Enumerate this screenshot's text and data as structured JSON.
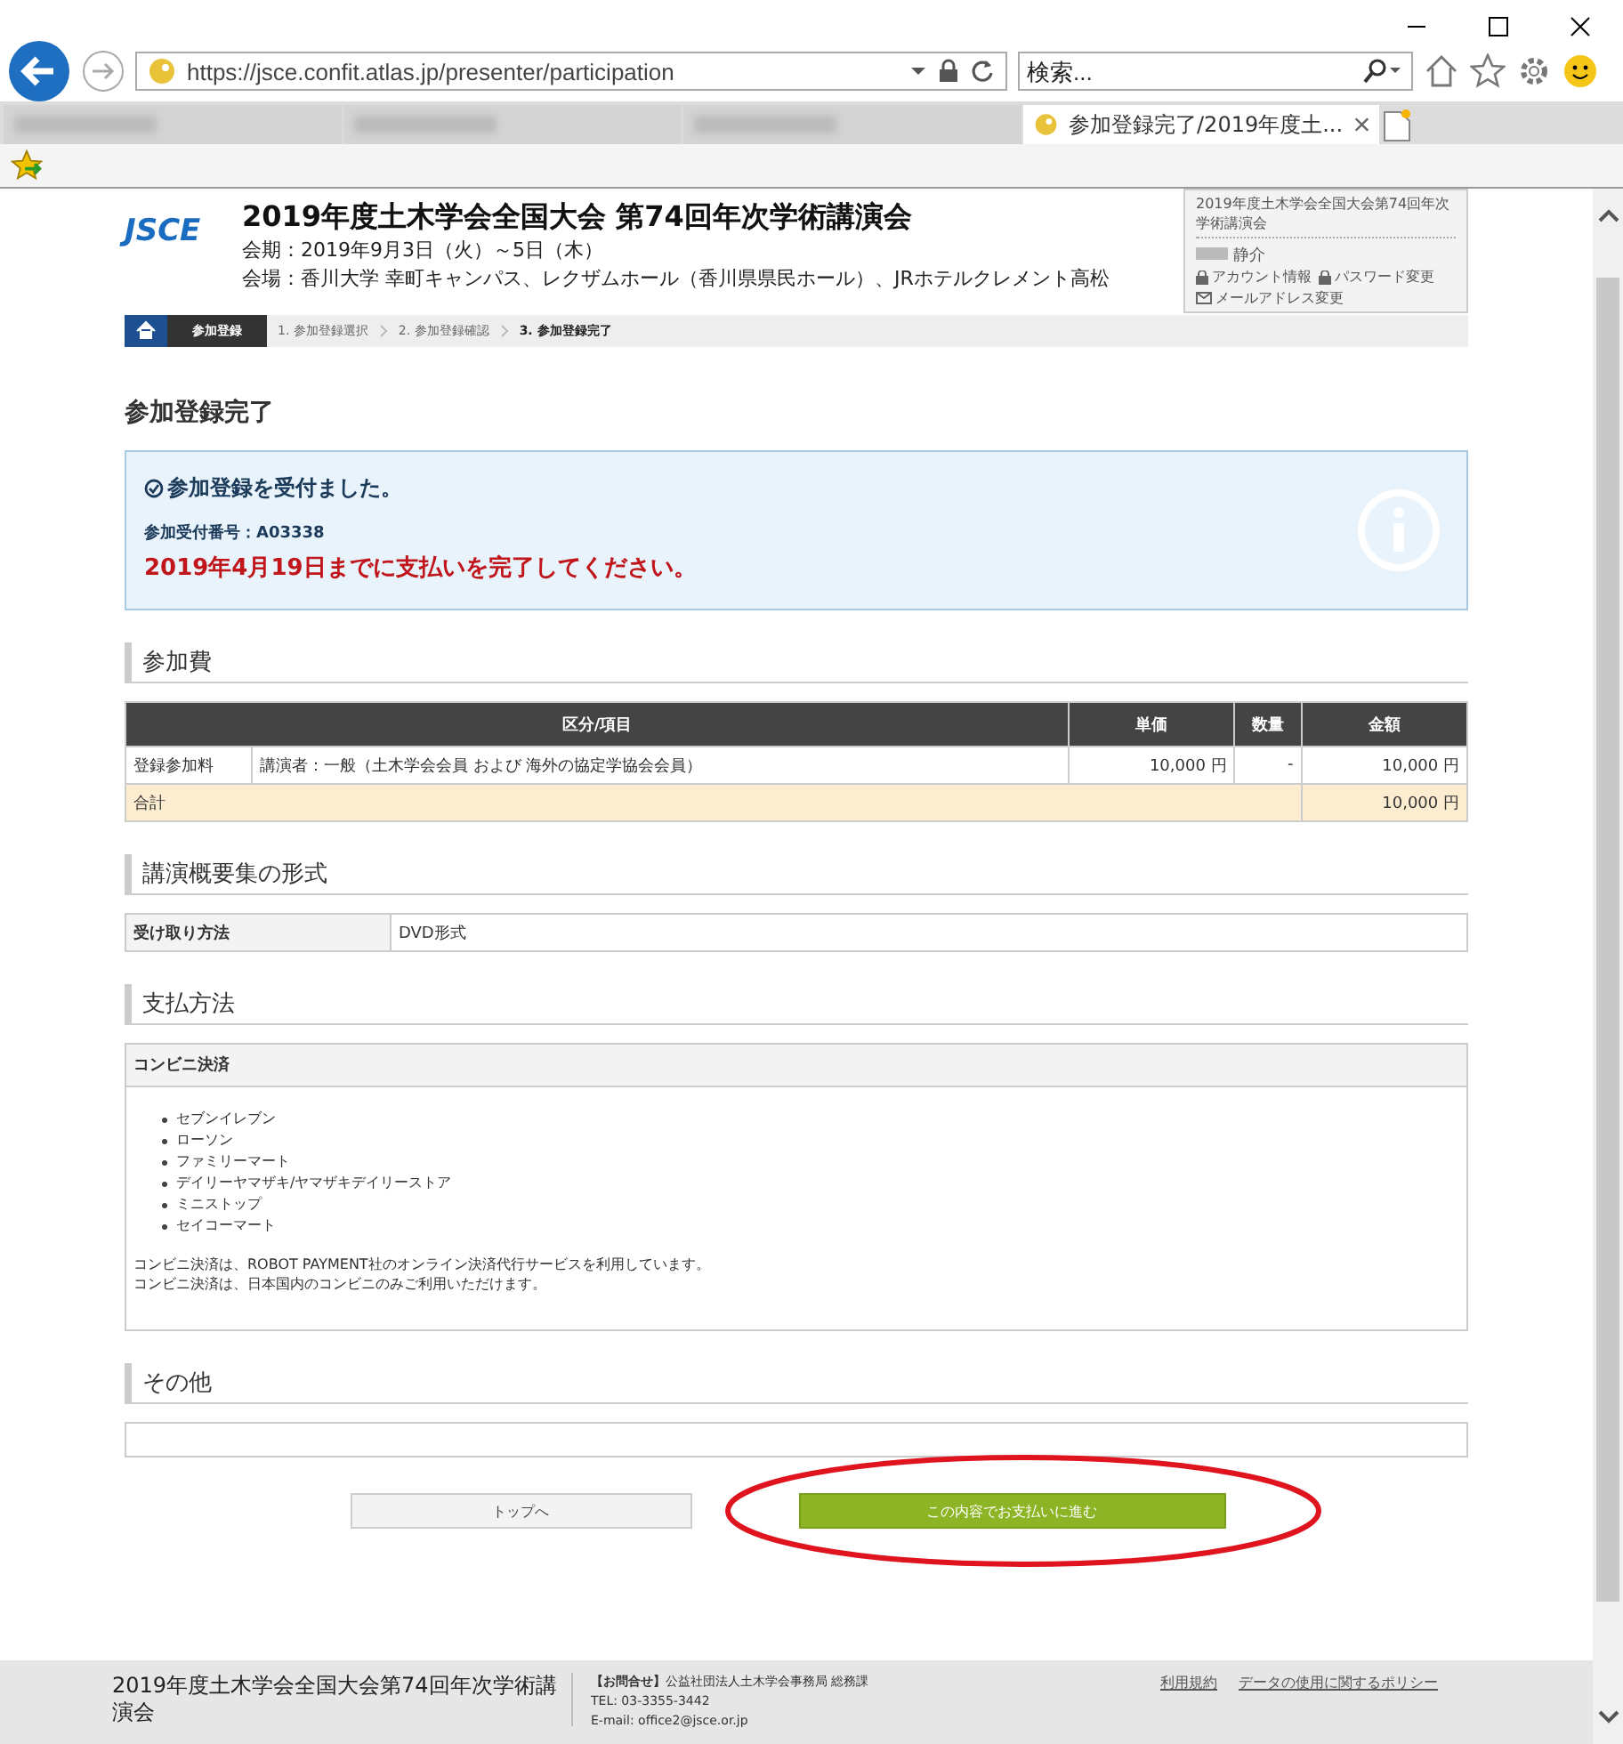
{
  "browser": {
    "url": "https://jsce.confit.atlas.jp/presenter/participation",
    "search_placeholder": "検索...",
    "tabs": [
      {
        "selected": false
      },
      {
        "selected": false
      },
      {
        "selected": false
      },
      {
        "label": "参加登録完了/2019年度土...",
        "selected": true
      }
    ]
  },
  "header": {
    "logo": "JSCE",
    "title": "2019年度土木学会全国大会 第74回年次学術講演会",
    "period": "会期：2019年9月3日（火）～5日（木）",
    "venue": "会場：香川大学 幸町キャンパス、レクザムホール（香川県県民ホール）、JRホテルクレメント高松"
  },
  "user_box": {
    "event": "2019年度土木学会全国大会第74回年次学術講演会",
    "name": "静介",
    "links": [
      {
        "kind": "lock",
        "label": "アカウント情報"
      },
      {
        "kind": "lock",
        "label": "パスワード変更"
      },
      {
        "kind": "mail",
        "label": "メールアドレス変更"
      }
    ]
  },
  "breadcrumb": [
    {
      "label": "参加登録",
      "selected": false,
      "kind": "section"
    },
    {
      "label": "1. 参加登録選択",
      "selected": false,
      "kind": "step"
    },
    {
      "label": "2. 参加登録確認",
      "selected": false,
      "kind": "step"
    },
    {
      "label": "3. 参加登録完了",
      "selected": true,
      "kind": "step"
    }
  ],
  "page_title": "参加登録完了",
  "notice": {
    "heading": "参加登録を受付ました。",
    "receipt": "参加受付番号：A03338",
    "deadline": "2019年4月19日までに支払いを完了してください。"
  },
  "fee": {
    "heading": "参加費",
    "columns": [
      "区分/項目",
      "単価",
      "数量",
      "金額"
    ],
    "rows": [
      {
        "category": "登録参加料",
        "item": "講演者：一般（土木学会会員 および 海外の協定学協会会員）",
        "unit_price": "10,000 円",
        "quantity": "-",
        "amount": "10,000 円"
      }
    ],
    "total": {
      "label": "合計",
      "amount": "10,000 円"
    }
  },
  "abstracts": {
    "heading": "講演概要集の形式",
    "label": "受け取り方法",
    "value": "DVD形式"
  },
  "payment": {
    "heading": "支払方法",
    "method": "コンビニ決済",
    "stores": [
      "セブンイレブン",
      "ローソン",
      "ファミリーマート",
      "デイリーヤマザキ/ヤマザキデイリーストア",
      "ミニストップ",
      "セイコーマート"
    ],
    "notes": [
      "コンビニ決済は、ROBOT PAYMENT社のオンライン決済代行サービスを利用しています。",
      "コンビニ決済は、日本国内のコンビニのみご利用いただけます。"
    ]
  },
  "other": {
    "heading": "その他"
  },
  "buttons": [
    {
      "kind": "secondary",
      "label": "トップへ"
    },
    {
      "kind": "primary",
      "label": "この内容でお支払いに進む"
    }
  ],
  "footer": {
    "title": "2019年度土木学会全国大会第74回年次学術講演会",
    "contact_label": "【お問合せ】",
    "contact_org": "公益社団法人土木学会事務局 総務課",
    "tel": "TEL: 03-3355-3442",
    "email": "E-mail: office2@jsce.or.jp",
    "links": [
      "利用規約",
      "データの使用に関するポリシー"
    ]
  }
}
